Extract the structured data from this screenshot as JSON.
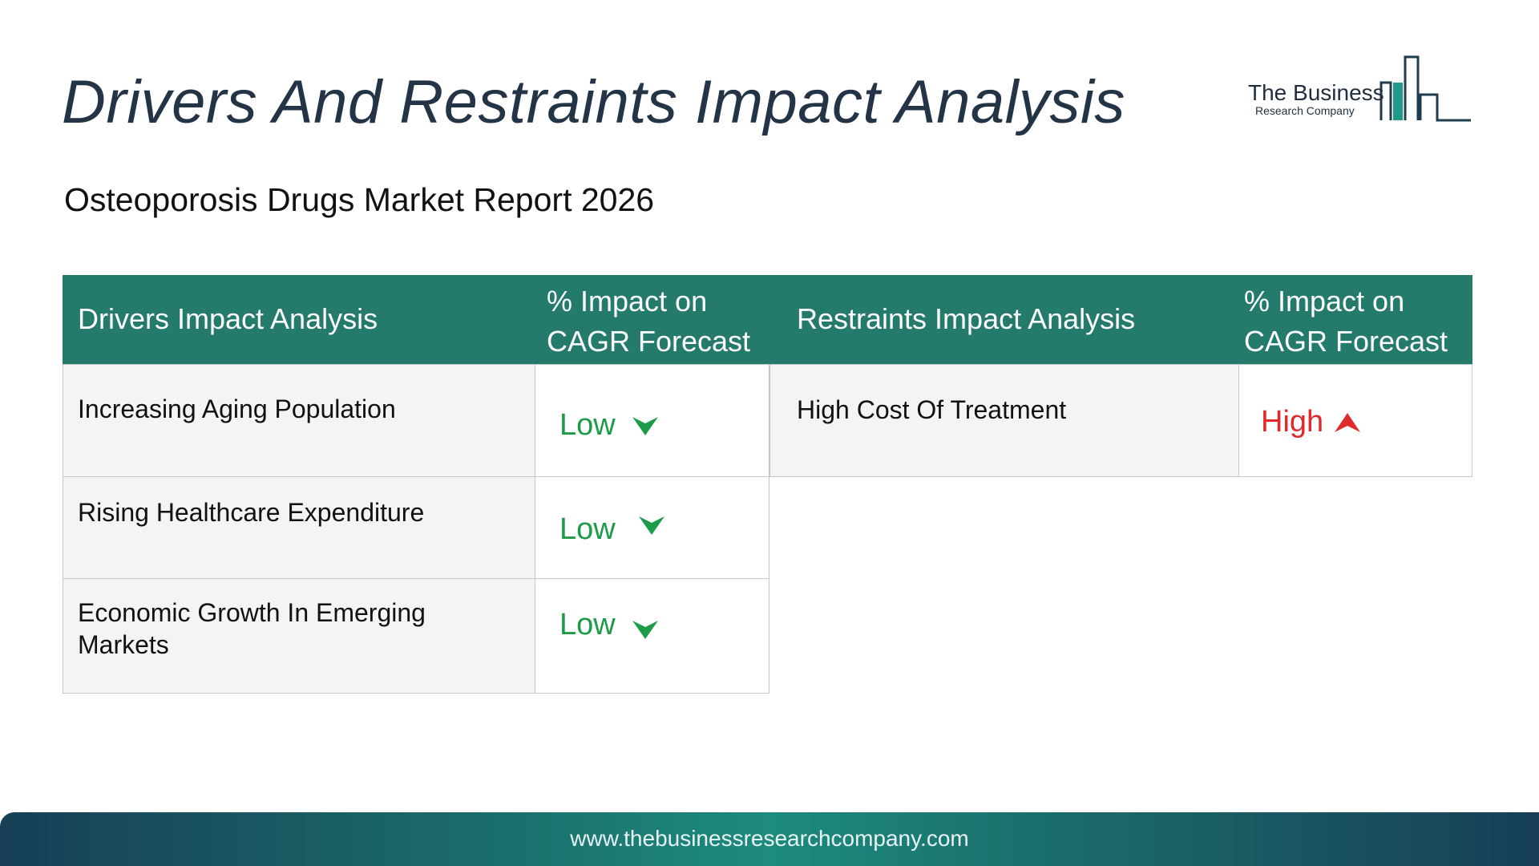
{
  "page": {
    "title": "Drivers And Restraints Impact Analysis",
    "subtitle": "Osteoporosis Drugs Market Report 2026"
  },
  "logo": {
    "line1": "The Business",
    "line2": "Research Company"
  },
  "table": {
    "drivers_header": "Drivers Impact Analysis",
    "drivers_impact_header_line1": "% Impact on",
    "drivers_impact_header_line2": "CAGR Forecast",
    "restraints_header": "Restraints Impact Analysis",
    "restraints_impact_header_line1": "% Impact on",
    "restraints_impact_header_line2": "CAGR Forecast",
    "drivers": [
      {
        "label": "Increasing Aging Population",
        "impact": "Low",
        "direction": "down"
      },
      {
        "label": "Rising Healthcare Expenditure",
        "impact": "Low",
        "direction": "down"
      },
      {
        "label": "Economic Growth In Emerging Markets",
        "impact": "Low",
        "direction": "down"
      }
    ],
    "restraints": [
      {
        "label": "High Cost Of Treatment",
        "impact": "High",
        "direction": "up"
      }
    ]
  },
  "colors": {
    "header_bg": "#247a6b",
    "low": "#1c9b48",
    "high": "#e02a2a",
    "title": "#243447"
  },
  "footer": {
    "url": "www.thebusinessresearchcompany.com"
  }
}
